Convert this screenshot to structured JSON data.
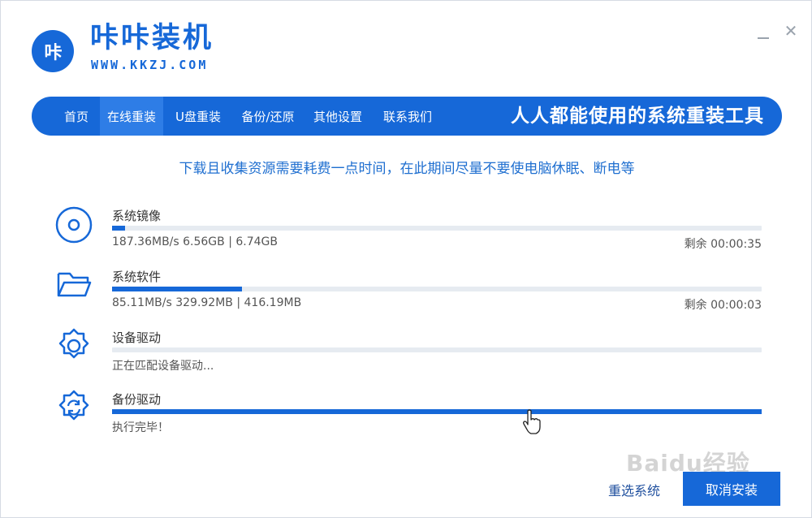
{
  "app": {
    "logo_text": "咔",
    "name": "咔咔装机",
    "url": "WWW.KKZJ.COM"
  },
  "window_controls": {
    "minimize_icon": "minimize-icon",
    "close_icon": "close-icon",
    "close_glyph": "✕"
  },
  "nav": {
    "items": [
      "首页",
      "在线重装",
      "U盘重装",
      "备份/还原",
      "其他设置",
      "联系我们"
    ],
    "active_index": 1,
    "slogan": "人人都能使用的系统重装工具"
  },
  "notice": "下载且收集资源需要耗费一点时间，在此期间尽量不要使电脑休眠、断电等",
  "tasks": [
    {
      "icon": "disc-icon",
      "title": "系统镜像",
      "progress": 0.02,
      "detail": "187.36MB/s 6.56GB | 6.74GB",
      "remaining": "剩余 00:00:35"
    },
    {
      "icon": "folder-icon",
      "title": "系统软件",
      "progress": 0.2,
      "detail": "85.11MB/s 329.92MB | 416.19MB",
      "remaining": "剩余 00:00:03"
    },
    {
      "icon": "gear-icon",
      "title": "设备驱动",
      "progress": 0.0,
      "detail": "正在匹配设备驱动...",
      "remaining": ""
    },
    {
      "icon": "gear-refresh-icon",
      "title": "备份驱动",
      "progress": 1.0,
      "detail": "执行完毕！",
      "remaining": ""
    }
  ],
  "buttons": {
    "reselect": "重选系统",
    "cancel": "取消安装"
  },
  "watermark": "Baidu经验",
  "colors": {
    "accent": "#1668d8",
    "track": "#e6ebf1",
    "notice": "#1f6fd0"
  }
}
